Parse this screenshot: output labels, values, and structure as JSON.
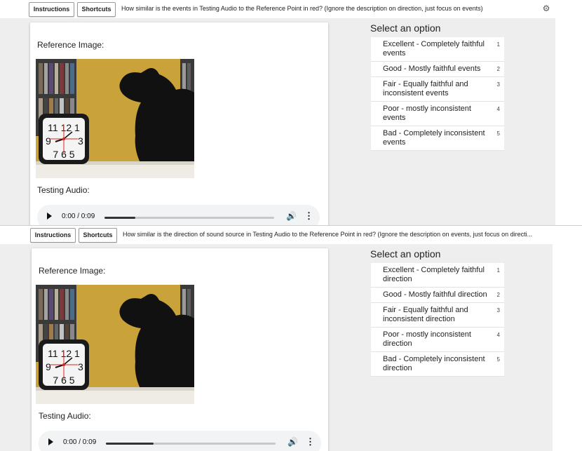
{
  "panels": [
    {
      "buttons": {
        "instructions": "Instructions",
        "shortcuts": "Shortcuts"
      },
      "question": "How similar is the events in Testing Audio to the Reference Point in red? (Ignore the description on direction, just focus on events)",
      "reference_label": "Reference Image:",
      "testing_label": "Testing Audio:",
      "audio": {
        "time": "0:00 / 0:09",
        "progress": 0.18
      },
      "select_title": "Select an option",
      "options": [
        {
          "label": "Excellent - Completely faithful events",
          "key": "1"
        },
        {
          "label": "Good - Mostly faithful events",
          "key": "2"
        },
        {
          "label": "Fair - Equally faithful and inconsistent events",
          "key": "3"
        },
        {
          "label": "Poor - mostly inconsistent events",
          "key": "4"
        },
        {
          "label": "Bad - Completely inconsistent events",
          "key": "5"
        }
      ]
    },
    {
      "buttons": {
        "instructions": "Instructions",
        "shortcuts": "Shortcuts"
      },
      "question": "How similar is the direction of sound source in Testing Audio to the Reference Point in red? (Ignore the description on events, just focus on directi...",
      "reference_label": "Reference Image:",
      "testing_label": "Testing Audio:",
      "audio": {
        "time": "0:00 / 0:09",
        "progress": 0.28
      },
      "select_title": "Select an option",
      "options": [
        {
          "label": "Excellent - Completely faithful direction",
          "key": "1"
        },
        {
          "label": "Good - Mostly faithful direction",
          "key": "2"
        },
        {
          "label": "Fair - Equally faithful and inconsistent direction",
          "key": "3"
        },
        {
          "label": "Poor - mostly inconsistent direction",
          "key": "4"
        },
        {
          "label": "Bad - Completely inconsistent direction",
          "key": "5"
        }
      ]
    }
  ],
  "icons": {
    "settings": "gear-icon",
    "play": "play-icon",
    "volume": "volume-icon",
    "more": "more-vertical-icon"
  }
}
